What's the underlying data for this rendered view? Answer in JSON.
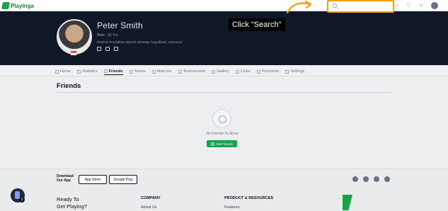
{
  "app": {
    "name": "Playinga"
  },
  "topbar": {
    "search": {
      "placeholder": ""
    },
    "icons": [
      "grid-icon",
      "bell-icon",
      "message-icon",
      "avatar"
    ]
  },
  "tooltip": {
    "text": "Click \"Search\""
  },
  "profile": {
    "name": "Peter Smith",
    "role": "Male · 22 Yrs",
    "location": "Provinsi Pendidikan Daerah Istimewa Yogyakarta, Indonesia",
    "socials": [
      "instagram-icon",
      "facebook-icon",
      "linkedin-icon"
    ]
  },
  "tabs": [
    {
      "label": "Home",
      "active": false
    },
    {
      "label": "Statistics",
      "active": false
    },
    {
      "label": "Friends",
      "active": true
    },
    {
      "label": "Teams",
      "active": false
    },
    {
      "label": "Matches",
      "active": false
    },
    {
      "label": "Tournaments",
      "active": false
    },
    {
      "label": "Gallery",
      "active": false
    },
    {
      "label": "Clubs",
      "active": false
    },
    {
      "label": "Payments",
      "active": false
    },
    {
      "label": "Settings",
      "active": false
    }
  ],
  "friends": {
    "title": "Friends",
    "empty_text": "No Friends To Show",
    "add_button": "Add Friends"
  },
  "footer": {
    "download_line1": "Download",
    "download_line2": "Our App",
    "app_store": "App Store",
    "google_play": "Google Play",
    "ready_line1": "Ready To",
    "ready_line2": "Get Playing?",
    "company_heading": "COMPANY",
    "company_link": "About Us",
    "product_heading": "PRODUCT & RESOURCES",
    "product_link": "Features"
  },
  "helper": {
    "count": "3"
  },
  "colors": {
    "accent": "#16a34a",
    "highlight": "#f59e0b",
    "banner": "#101827"
  }
}
